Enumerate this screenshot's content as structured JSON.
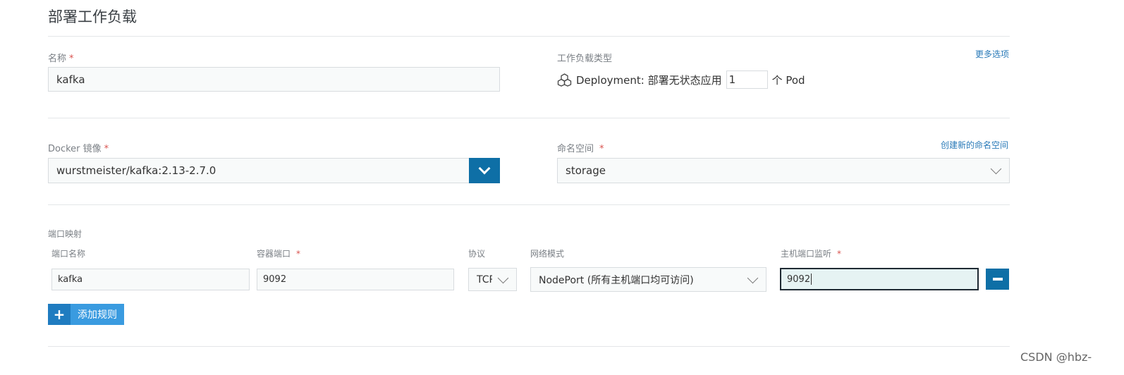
{
  "page": {
    "title": "部署工作负载"
  },
  "name": {
    "label": "名称",
    "required_mark": "*",
    "value": "kafka"
  },
  "workload_type": {
    "label": "工作负载类型",
    "more_options": "更多选项",
    "icon": "cluster-icon",
    "description": "Deployment: 部署无状态应用",
    "pod_count": "1",
    "pod_suffix": "个 Pod"
  },
  "docker_image": {
    "label": "Docker 镜像",
    "required_mark": "*",
    "value": "wurstmeister/kafka:2.13-2.7.0"
  },
  "namespace": {
    "label": "命名空间",
    "required_mark": "*",
    "create_link": "创建新的命名空间",
    "value": "storage"
  },
  "port_mapping": {
    "section_label": "端口映射",
    "headers": {
      "port_name": "端口名称",
      "container_port": "容器端口",
      "protocol": "协议",
      "network_mode": "网络模式",
      "host_port": "主机端口监听"
    },
    "required_mark": "*",
    "rows": [
      {
        "port_name": "kafka",
        "container_port": "9092",
        "protocol": "TCP",
        "network_mode": "NodePort (所有主机端口均可访问)",
        "host_port": "9092"
      }
    ],
    "add_rule": "添加规则"
  },
  "watermark": "CSDN @hbz-",
  "colors": {
    "primary_button": "#0e6fa6",
    "add_button": "#3a9be0",
    "required": "#d9534f",
    "link": "#2a7ab8"
  }
}
